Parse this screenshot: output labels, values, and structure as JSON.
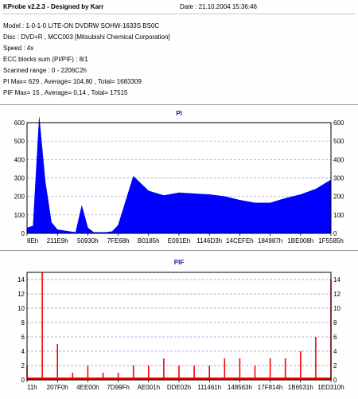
{
  "info": {
    "app_title": "KProbe v2.2.3 - Designed by Karr",
    "date": "Date : 21.10.2004 15:36:46",
    "lines": [
      "Model : 1-0-1-0 LITE-ON DVDRW SOHW-1633S BS0C",
      "Disc : DVD+R , MCC003 [Mitsubishi Chemical Corporation]",
      "Speed : 4x",
      "ECC blocks sum (PI/PIF) : 8/1",
      "Scanned range : 0 - 2206C2h",
      "PI Max= 629 , Average= 104,80 , Total= 1683309",
      "PIF Max= 15 , Average= 0,14 , Total= 17515"
    ]
  },
  "chart_data": [
    {
      "type": "area",
      "title": "PI",
      "color": "#0000ff",
      "ylim": [
        0,
        600
      ],
      "yticks": [
        0,
        100,
        200,
        300,
        400,
        500,
        600
      ],
      "ytick_labels": [
        "0",
        "100",
        "200",
        "300",
        "400",
        "500",
        "600"
      ],
      "xtick_labels": [
        "8Eh",
        "211E9h",
        "50930h",
        "7FE68h",
        "B0185h",
        "E091Eh",
        "1146D3h",
        "14CEFEh",
        "184987h",
        "1BE008h",
        "1F5585h"
      ],
      "grid": true,
      "x": [
        0,
        2,
        4,
        6,
        8,
        10,
        12,
        14,
        16,
        18,
        20,
        22,
        24,
        26,
        28,
        30,
        35,
        40,
        45,
        50,
        55,
        60,
        65,
        70,
        75,
        80,
        85,
        90,
        95,
        100
      ],
      "values": [
        30,
        40,
        629,
        280,
        60,
        20,
        15,
        10,
        5,
        150,
        30,
        5,
        5,
        5,
        10,
        45,
        310,
        230,
        205,
        220,
        215,
        210,
        200,
        180,
        165,
        165,
        190,
        210,
        240,
        290
      ]
    },
    {
      "type": "bar",
      "title": "PIF",
      "color": "#ff0000",
      "ylim": [
        0,
        15
      ],
      "yticks": [
        0,
        2,
        4,
        6,
        8,
        10,
        12,
        14
      ],
      "ytick_labels": [
        "0",
        "2",
        "4",
        "6",
        "8",
        "10",
        "12",
        "14"
      ],
      "xtick_labels": [
        "11h",
        "207F0h",
        "4EE00h",
        "7D99Fh",
        "AE001h",
        "DDE02h",
        "111461h",
        "148563h",
        "17F814h",
        "1B6531h",
        "1ED310h"
      ],
      "grid": true,
      "x": [
        0,
        5,
        10,
        15,
        20,
        25,
        30,
        35,
        40,
        45,
        50,
        55,
        60,
        65,
        70,
        75,
        80,
        85,
        90,
        95,
        100
      ],
      "values": [
        2,
        15,
        5,
        1,
        2,
        1,
        1,
        2,
        2,
        3,
        2,
        2,
        2,
        3,
        3,
        2,
        3,
        3,
        4,
        6,
        14
      ]
    }
  ]
}
